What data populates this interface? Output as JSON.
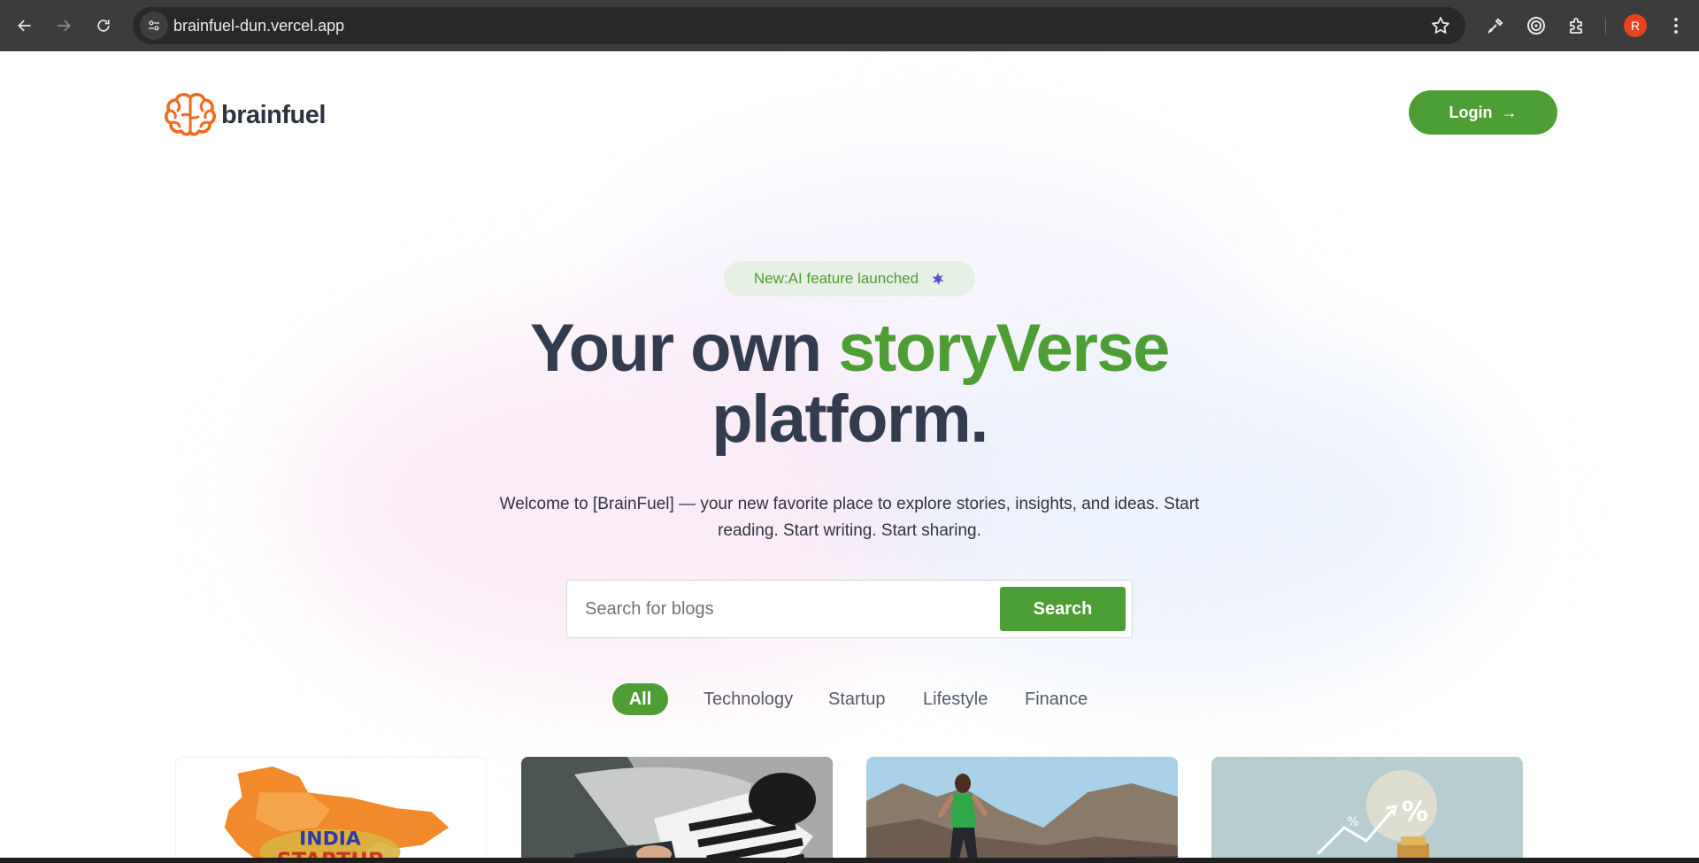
{
  "browser": {
    "url": "brainfuel-dun.vercel.app",
    "profile_initial": "R"
  },
  "header": {
    "logo_text": "brainfuel",
    "login_label": "Login",
    "login_arrow": "→"
  },
  "hero": {
    "badge_text": "New:AI feature launched",
    "title_part1": "Your own ",
    "title_accent": "storyVerse",
    "title_part2": "platform.",
    "subtitle": "Welcome to [BrainFuel] — your new favorite place to explore stories, insights, and ideas. Start reading. Start writing. Start sharing."
  },
  "search": {
    "placeholder": "Search for blogs",
    "button_label": "Search"
  },
  "categories": [
    "All",
    "Technology",
    "Startup",
    "Lifestyle",
    "Finance"
  ],
  "cards": [
    {
      "image_label": "INDIA STARTUP"
    },
    {
      "image_label": ""
    },
    {
      "image_label": ""
    },
    {
      "image_label": "%"
    }
  ],
  "colors": {
    "brand_green": "#4d9e34",
    "logo_orange": "#f26a1b",
    "heading_dark": "#333c4e"
  }
}
